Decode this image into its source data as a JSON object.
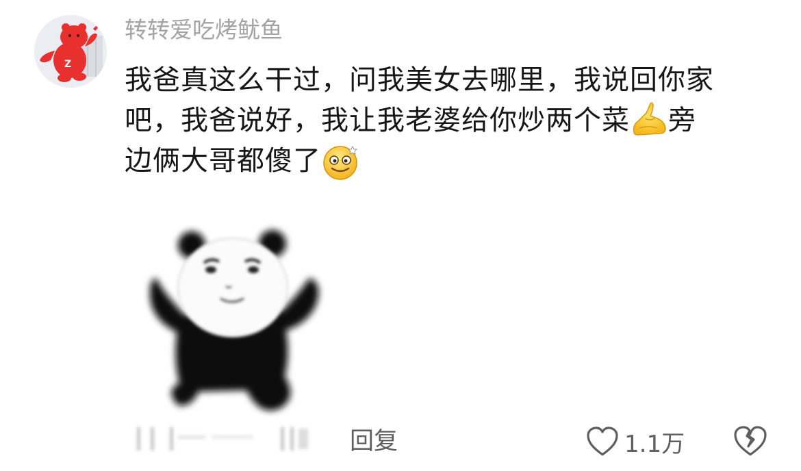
{
  "comment": {
    "username": "转转爱吃烤鱿鱼",
    "avatar_icon": "red-bear-avatar-icon",
    "text_lines": [
      "我爸真这么干过，问我美女去哪里，我说回你家",
      "吧，我爸说好，我让我老婆给你炒两个菜",
      "旁",
      "边俩大哥都傻了"
    ],
    "emojis": [
      "ok-hand-emoji",
      "dizzy-face-emoji"
    ],
    "sticker_icon": "panda-meme-sticker",
    "actions": {
      "reply_label": "回复",
      "like_count": "1.1万",
      "like_icon": "heart-outline-icon",
      "dislike_icon": "broken-heart-icon"
    },
    "colors": {
      "username": "#a3a3a3",
      "text": "#161616",
      "action_text": "#5e5e5e",
      "avatar_bear": "#e8312f"
    }
  }
}
